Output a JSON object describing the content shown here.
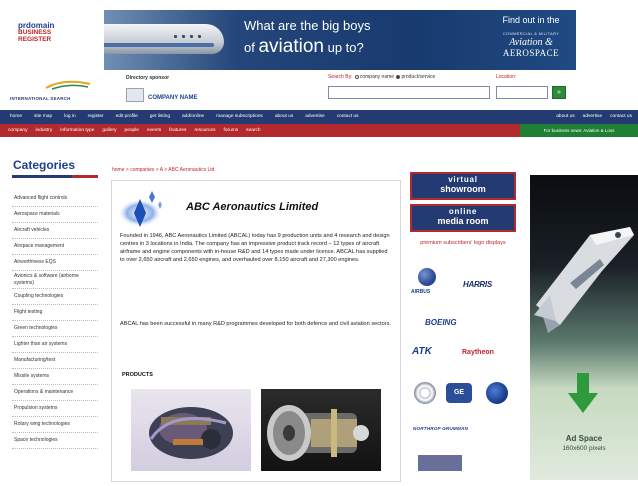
{
  "header": {
    "logo": {
      "line1": "prdomain",
      "line2": "BUSINESS",
      "line3": "REGISTER"
    },
    "intl_label": "INTERNATIONAL SEARCH",
    "sponsor_label": "Directory sponsor",
    "company_name": "COMPANY NAME"
  },
  "banner": {
    "line1": "What are the big boys",
    "line2_prefix": "of",
    "line2_big": "aviation",
    "line2_suffix": "up to?",
    "find_out": "Find out in the",
    "small": "COMMERCIAL & MILITARY",
    "brand1": "Aviation &",
    "brand2": "AEROSPACE"
  },
  "search": {
    "search_by": "Search By:",
    "option_company": "company name",
    "option_product": "product/service",
    "location_label": "Location:",
    "query": "",
    "location": "",
    "go_label": "»"
  },
  "nav_primary": {
    "items": [
      "home",
      "site map",
      "log in",
      "register",
      "edit profile",
      "get listing",
      "add/online",
      "manage subscriptions",
      "about us",
      "advertise",
      "contact us"
    ],
    "right_items": [
      "about us",
      "advertise",
      "contact us"
    ]
  },
  "nav_secondary": {
    "items": [
      "company",
      "industry",
      "information type",
      "gallery",
      "people",
      "events",
      "features",
      "resources",
      "forums",
      "search"
    ],
    "right_label": "For business news: Aviation & Loss"
  },
  "sidebar": {
    "title": "Categories",
    "items": [
      "Advanced flight controls",
      "Aerospace materials",
      "Aircraft vehicles",
      "Airspace management",
      "Airworthiness EQS",
      "Avionics & software (airborne systems)",
      "Coupling technologies",
      "Flight testing",
      "Green technologies",
      "Lighter than air systems",
      "Manufacturing/test",
      "Missile systems",
      "Operations & maintenance",
      "Propulsion systems",
      "Rotary wing technologies",
      "Space technologies"
    ]
  },
  "content": {
    "breadcrumb": "home > companies > A > ABC Aeronautics Ltd",
    "company_name": "ABC Aeronautics Limited",
    "paragraph1": "Founded in 1946, ABC Aeronautics Limited (ABCAL) today has 9 production units and 4 research and design centres in 3 locations in India. The company has an impressive product track record – 12 types of aircraft airframe and engine components with in-house R&D and 14 types made under licence. ABCAL has supplied to over 2,650 aircraft and 2,650 engines, and overhauled over 8,150 aircraft and 27,300 engines.",
    "paragraph2": "ABCAL has been successful in many R&D programmes developed for both defence and civil aviation sectors.",
    "products_title": "PRODUCTS"
  },
  "sponsors": {
    "virtual_showroom": {
      "top": "virtual",
      "bottom": "showroom"
    },
    "media_room": {
      "top": "online",
      "bottom": "media room"
    },
    "premium_text": "premium subscribers' logo displays",
    "logos": {
      "airbus": "AIRBUS",
      "harris": "HARRIS",
      "boeing": "BOEING",
      "atk": "ATK",
      "raytheon": "Raytheon",
      "ge": "GE",
      "northrop": "NORTHROP GRUMMAN"
    }
  },
  "ad": {
    "title": "Ad Space",
    "size": "160x600 pixels"
  },
  "colors": {
    "navy": "#243a73",
    "red": "#b22a2e",
    "green": "#1f7f35",
    "link_red": "#c0232c"
  }
}
